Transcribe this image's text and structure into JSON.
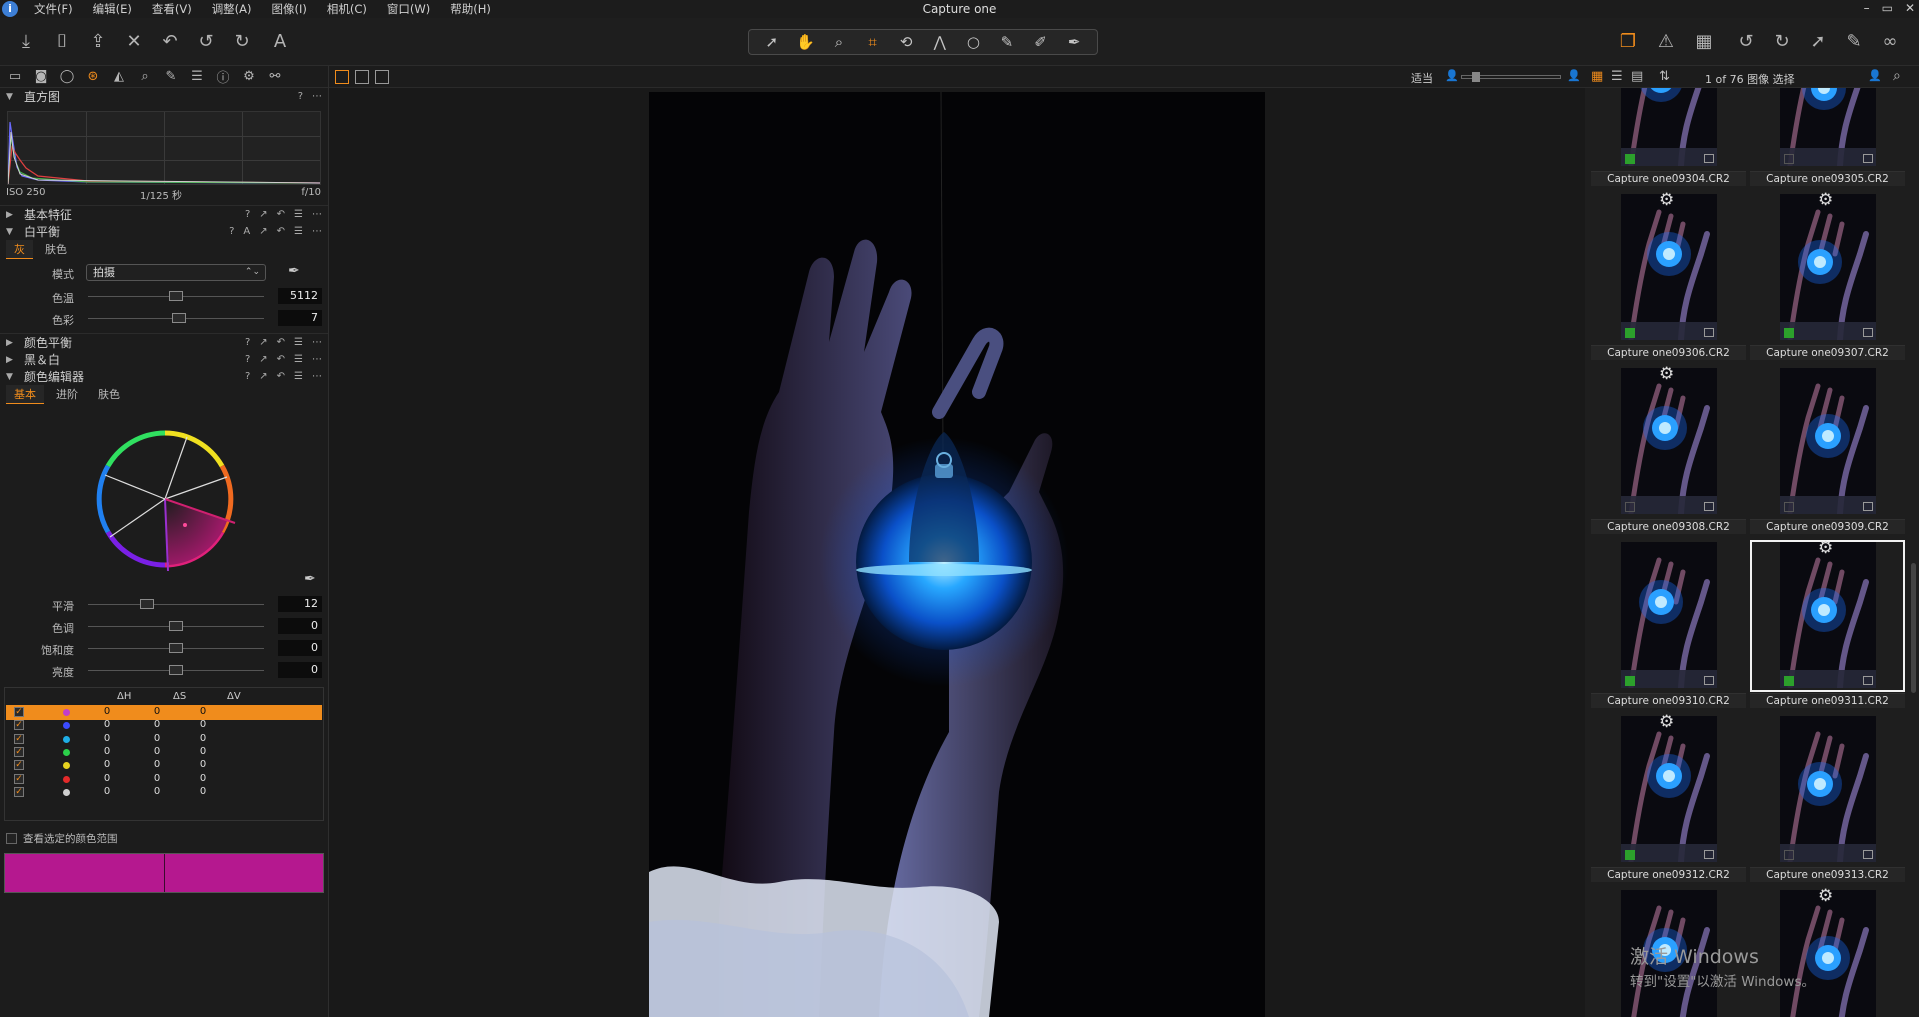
{
  "app": {
    "title": "Capture one",
    "logo": "i"
  },
  "menu": [
    "文件(F)",
    "编辑(E)",
    "查看(V)",
    "调整(A)",
    "图像(I)",
    "相机(C)",
    "窗口(W)",
    "帮助(H)"
  ],
  "window_controls": [
    "–",
    "▭",
    "✕"
  ],
  "toolbar": {
    "left_icons": [
      "import-icon",
      "camera-icon",
      "move-icon",
      "delete-icon",
      "undo-icon",
      "undo-alt-icon",
      "redo-icon",
      "text-icon"
    ],
    "cursor_tools": [
      "select-cursor-icon",
      "pan-hand-icon",
      "loupe-icon",
      "crop-icon",
      "rotate-icon",
      "keystone-icon",
      "spot-remove-icon",
      "brush-icon",
      "erase-icon",
      "gradient-icon"
    ],
    "right_icons": [
      "variants-icon",
      "warning-icon",
      "grid-icon",
      "rotate-left-icon",
      "rotate-right-icon",
      "export-icon",
      "edit-icon",
      "glasses-icon"
    ]
  },
  "tool_tabs": [
    "library-icon",
    "capture-icon",
    "lens-icon",
    "color-icon",
    "exposure-icon",
    "details-icon",
    "local-adjust-icon",
    "output-icon",
    "metadata-icon",
    "settings-icon",
    "batch-icon"
  ],
  "histogram": {
    "title": "直方图",
    "iso": "ISO 250",
    "shutter": "1/125 秒",
    "aperture": "f/10"
  },
  "panels": {
    "basic": "基本特征",
    "wb": "白平衡",
    "color_balance": "颜色平衡",
    "bw": "黑＆白",
    "color_editor": "颜色编辑器"
  },
  "wb": {
    "tabs": [
      "灰",
      "肤色"
    ],
    "mode_label": "模式",
    "mode_value": "拍摄",
    "kelvin_label": "色温",
    "kelvin_value": "5112",
    "kelvin_pos": 0.5,
    "tint_label": "色彩",
    "tint_value": "7",
    "tint_pos": 0.52
  },
  "color_editor": {
    "tabs": [
      "基本",
      "进阶",
      "肤色"
    ],
    "smooth": {
      "label": "平滑",
      "value": "12",
      "pos": 0.32
    },
    "hue": {
      "label": "色调",
      "value": "0",
      "pos": 0.5
    },
    "saturation": {
      "label": "饱和度",
      "value": "0",
      "pos": 0.5
    },
    "lightness": {
      "label": "亮度",
      "value": "0",
      "pos": 0.5
    },
    "columns": [
      "ΔH",
      "ΔS",
      "ΔV"
    ],
    "rows": [
      {
        "color": "#c23ecb",
        "h": "0",
        "s": "0",
        "v": "0",
        "selected": true
      },
      {
        "color": "#3b4bff",
        "h": "0",
        "s": "0",
        "v": "0"
      },
      {
        "color": "#1faee6",
        "h": "0",
        "s": "0",
        "v": "0"
      },
      {
        "color": "#2bd04a",
        "h": "0",
        "s": "0",
        "v": "0"
      },
      {
        "color": "#e6d21f",
        "h": "0",
        "s": "0",
        "v": "0"
      },
      {
        "color": "#e42a2a",
        "h": "0",
        "s": "0",
        "v": "0"
      },
      {
        "color": "#cfcfcf",
        "h": "0",
        "s": "0",
        "v": "0"
      }
    ],
    "view_range_label": "查看选定的颜色范围",
    "swatch_color": "#b5188f"
  },
  "viewer": {
    "fit_label": "适当"
  },
  "browser": {
    "count_label": "1 of 76 图像 选择",
    "thumbs": [
      {
        "name": "Capture one09304.CR2",
        "tag": "#2ca02c",
        "gear": false
      },
      {
        "name": "Capture one09305.CR2",
        "tag": "",
        "gear": false
      },
      {
        "name": "Capture one09306.CR2",
        "tag": "#2ca02c",
        "gear": true
      },
      {
        "name": "Capture one09307.CR2",
        "tag": "#2ca02c",
        "gear": true
      },
      {
        "name": "Capture one09308.CR2",
        "tag": "",
        "gear": true
      },
      {
        "name": "Capture one09309.CR2",
        "tag": "",
        "gear": false
      },
      {
        "name": "Capture one09310.CR2",
        "tag": "#2ca02c",
        "gear": false
      },
      {
        "name": "Capture one09311.CR2",
        "tag": "#2ca02c",
        "gear": true,
        "selected": true
      },
      {
        "name": "Capture one09312.CR2",
        "tag": "#2ca02c",
        "gear": true
      },
      {
        "name": "Capture one09313.CR2",
        "tag": "",
        "gear": false
      },
      {
        "name": "",
        "tag": "",
        "gear": false
      },
      {
        "name": "",
        "tag": "",
        "gear": true
      }
    ]
  },
  "watermark": {
    "line1": "激活 Windows",
    "line2": "转到\"设置\"以激活 Windows。"
  }
}
